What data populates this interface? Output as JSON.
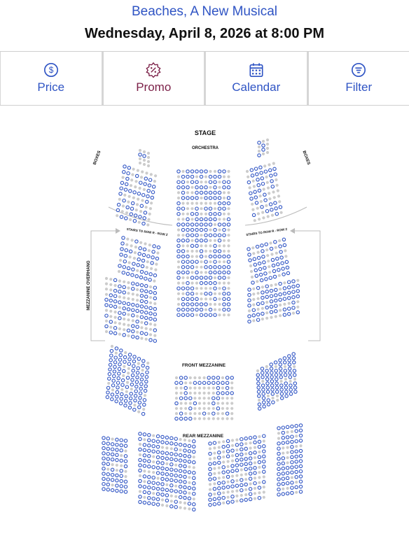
{
  "header": {
    "show_title": "Beaches, A New Musical",
    "performance": "Wednesday, April 8, 2026 at 8:00 PM"
  },
  "toolbar": [
    {
      "label": "Price",
      "icon": "dollar-circle-icon",
      "color": "#2f54c4"
    },
    {
      "label": "Promo",
      "icon": "discount-badge-icon",
      "color": "#7b1f47"
    },
    {
      "label": "Calendar",
      "icon": "calendar-icon",
      "color": "#2f54c4"
    },
    {
      "label": "Filter",
      "icon": "filter-icon",
      "color": "#2f54c4"
    }
  ],
  "seatmap": {
    "stage": "STAGE",
    "orchestra": "ORCHESTRA",
    "boxes_left": "BOXES",
    "boxes_right": "BOXES",
    "stairs_left": "STAIRS TO ROW R - ROW Z",
    "stairs_right": "STAIRS TO ROW R - ROW Z",
    "mezzanine_overhang": "MEZZANINE OVERHANG",
    "front_mezzanine": "FRONT MEZZANINE",
    "rear_mezzanine": "REAR MEZZANINE",
    "available_color": "#2f54c4",
    "unavailable_color": "#cccccc"
  }
}
